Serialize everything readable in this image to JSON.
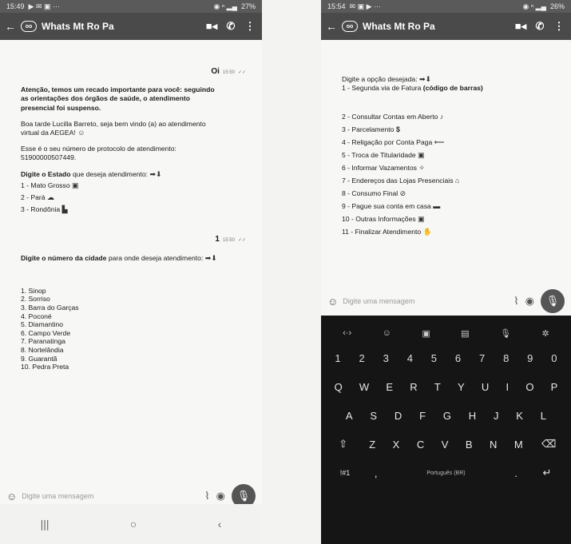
{
  "left": {
    "status": {
      "time": "15:49",
      "battery": "27%"
    },
    "header": {
      "title": "Whats Mt Ro Pa"
    },
    "user_message_1": {
      "text": "Oi",
      "time": "15:50"
    },
    "bot_message_1": {
      "warning": "Atenção, temos um recado importante para você: seguindo as orientações dos órgãos de saúde, o atendimento presencial foi suspenso.",
      "greeting": "Boa tarde Lucilla Barreto, seja bem vindo (a) ao atendimento virtual da AEGEA!",
      "protocol": "Esse é o seu número de protocolo de atendimento: 51900000507449.",
      "state_prompt_bold": "Digite o Estado",
      "state_prompt_rest": " que deseja atendimento:",
      "options": [
        "1 - Mato Grosso",
        "2 - Pará",
        "3 - Rondônia"
      ]
    },
    "user_message_2": {
      "text": "1",
      "time": "15:50"
    },
    "bot_message_2": {
      "prompt_bold": "Digite o número da cidade",
      "prompt_rest": " para onde deseja atendimento:",
      "cities": [
        "1. Sinop",
        "2. Sorriso",
        "3. Barra do Garças",
        "4. Poconé",
        "5. Diamantino",
        "6. Campo Verde",
        "7. Paranatinga",
        "8. Nortelândia",
        "9. Guarantã",
        "10. Pedra Preta"
      ]
    },
    "input": {
      "placeholder": "Digite uma mensagem"
    }
  },
  "right": {
    "status": {
      "time": "15:54",
      "battery": "26%"
    },
    "header": {
      "title": "Whats Mt Ro Pa"
    },
    "bot_message": {
      "prompt": "Digite a opção desejada:",
      "option_1": "1 - Segunda via de Fatura ",
      "option_1_bold": "(código de barras)",
      "options": [
        "2 - Consultar Contas em Aberto",
        "3 - Parcelamento",
        "4 - Religação por Conta Paga",
        "5 - Troca de Titularidade",
        "6 - Informar Vazamentos",
        "7 - Endereços das Lojas Presenciais",
        "8 - Consumo Final",
        "9 - Pague sua conta em casa",
        "10 - Outras Informações",
        "11 - Finalizar Atendimento"
      ]
    },
    "input": {
      "placeholder": "Digite uma mensagem"
    },
    "keyboard": {
      "numbers": [
        "1",
        "2",
        "3",
        "4",
        "5",
        "6",
        "7",
        "8",
        "9",
        "0"
      ],
      "row1": [
        "Q",
        "W",
        "E",
        "R",
        "T",
        "Y",
        "U",
        "I",
        "O",
        "P"
      ],
      "row2": [
        "A",
        "S",
        "D",
        "F",
        "G",
        "H",
        "J",
        "K",
        "L"
      ],
      "row3": [
        "Z",
        "X",
        "C",
        "V",
        "B",
        "N",
        "M"
      ],
      "symbols_key": "!#1",
      "comma": ",",
      "space_label": "Português (BR)",
      "period": "."
    }
  }
}
